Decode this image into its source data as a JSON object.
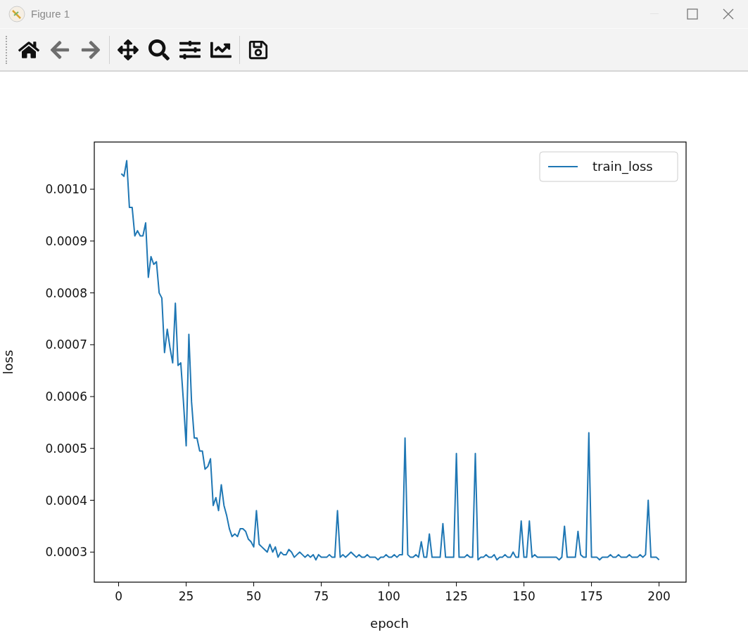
{
  "window": {
    "title": "Figure 1"
  },
  "toolbar": [
    {
      "kind": "home",
      "disabled": false
    },
    {
      "kind": "back",
      "disabled": true
    },
    {
      "kind": "forward",
      "disabled": true
    },
    {
      "kind": "pan",
      "disabled": false
    },
    {
      "kind": "zoom",
      "disabled": false
    },
    {
      "kind": "subplots",
      "disabled": false
    },
    {
      "kind": "axes",
      "disabled": false
    },
    {
      "kind": "save",
      "disabled": false
    }
  ],
  "figure": {
    "chart_data": {
      "type": "line",
      "xlabel": "epoch",
      "ylabel": "loss",
      "xlim": [
        -9,
        210
      ],
      "ylim": [
        0.000242,
        0.001091
      ],
      "xticks": [
        0,
        25,
        50,
        75,
        100,
        125,
        150,
        175,
        200
      ],
      "yticks": [
        {
          "value": 0.0003,
          "label": "0.0003"
        },
        {
          "value": 0.0004,
          "label": "0.0004"
        },
        {
          "value": 0.0005,
          "label": "0.0005"
        },
        {
          "value": 0.0006,
          "label": "0.0006"
        },
        {
          "value": 0.0007,
          "label": "0.0007"
        },
        {
          "value": 0.0008,
          "label": "0.0008"
        },
        {
          "value": 0.0009,
          "label": "0.0009"
        },
        {
          "value": 0.001,
          "label": "0.0010"
        }
      ],
      "x": [
        1,
        2,
        3,
        4,
        5,
        6,
        7,
        8,
        9,
        10,
        11,
        12,
        13,
        14,
        15,
        16,
        17,
        18,
        19,
        20,
        21,
        22,
        23,
        24,
        25,
        26,
        27,
        28,
        29,
        30,
        31,
        32,
        33,
        34,
        35,
        36,
        37,
        38,
        39,
        40,
        41,
        42,
        43,
        44,
        45,
        46,
        47,
        48,
        49,
        50,
        51,
        52,
        53,
        54,
        55,
        56,
        57,
        58,
        59,
        60,
        61,
        62,
        63,
        64,
        65,
        66,
        67,
        68,
        69,
        70,
        71,
        72,
        73,
        74,
        75,
        76,
        77,
        78,
        79,
        80,
        81,
        82,
        83,
        84,
        85,
        86,
        87,
        88,
        89,
        90,
        91,
        92,
        93,
        94,
        95,
        96,
        97,
        98,
        99,
        100,
        101,
        102,
        103,
        104,
        105,
        106,
        107,
        108,
        109,
        110,
        111,
        112,
        113,
        114,
        115,
        116,
        117,
        118,
        119,
        120,
        121,
        122,
        123,
        124,
        125,
        126,
        127,
        128,
        129,
        130,
        131,
        132,
        133,
        134,
        135,
        136,
        137,
        138,
        139,
        140,
        141,
        142,
        143,
        144,
        145,
        146,
        147,
        148,
        149,
        150,
        151,
        152,
        153,
        154,
        155,
        156,
        157,
        158,
        159,
        160,
        161,
        162,
        163,
        164,
        165,
        166,
        167,
        168,
        169,
        170,
        171,
        172,
        173,
        174,
        175,
        176,
        177,
        178,
        179,
        180,
        181,
        182,
        183,
        184,
        185,
        186,
        187,
        188,
        189,
        190,
        191,
        192,
        193,
        194,
        195,
        196,
        197,
        198,
        199,
        200
      ],
      "series": [
        {
          "name": "train_loss",
          "color": "#1f77b4",
          "values": [
            0.00103,
            0.001025,
            0.001055,
            0.000965,
            0.000965,
            0.00091,
            0.00092,
            0.00091,
            0.00091,
            0.000935,
            0.00083,
            0.00087,
            0.000855,
            0.00086,
            0.0008,
            0.00079,
            0.000685,
            0.00073,
            0.000695,
            0.000665,
            0.00078,
            0.00066,
            0.000665,
            0.00059,
            0.000505,
            0.00072,
            0.00059,
            0.00052,
            0.00052,
            0.000495,
            0.000495,
            0.00046,
            0.000465,
            0.00048,
            0.00039,
            0.000405,
            0.00038,
            0.00043,
            0.00039,
            0.00037,
            0.000345,
            0.00033,
            0.000335,
            0.00033,
            0.000345,
            0.000345,
            0.00034,
            0.000325,
            0.00032,
            0.00031,
            0.00038,
            0.000315,
            0.00031,
            0.000305,
            0.0003,
            0.000315,
            0.0003,
            0.00031,
            0.00029,
            0.0003,
            0.000295,
            0.000295,
            0.000305,
            0.0003,
            0.00029,
            0.000295,
            0.0003,
            0.000295,
            0.00029,
            0.000295,
            0.00029,
            0.000295,
            0.000285,
            0.000295,
            0.00029,
            0.00029,
            0.00029,
            0.000295,
            0.00029,
            0.00029,
            0.00038,
            0.00029,
            0.000295,
            0.00029,
            0.000295,
            0.0003,
            0.000295,
            0.00029,
            0.000295,
            0.00029,
            0.00029,
            0.000295,
            0.00029,
            0.00029,
            0.00029,
            0.000285,
            0.00029,
            0.00029,
            0.000295,
            0.00029,
            0.00029,
            0.000295,
            0.00029,
            0.000295,
            0.000295,
            0.00052,
            0.000295,
            0.00029,
            0.00029,
            0.000295,
            0.00029,
            0.00032,
            0.00029,
            0.00029,
            0.000335,
            0.00029,
            0.00029,
            0.00029,
            0.00029,
            0.000355,
            0.00029,
            0.00029,
            0.00029,
            0.00029,
            0.00049,
            0.00029,
            0.00029,
            0.00029,
            0.000295,
            0.00029,
            0.00029,
            0.00049,
            0.000285,
            0.00029,
            0.00029,
            0.000295,
            0.00029,
            0.00029,
            0.000295,
            0.000285,
            0.00029,
            0.00029,
            0.000295,
            0.00029,
            0.00029,
            0.0003,
            0.00029,
            0.00029,
            0.00036,
            0.00029,
            0.00029,
            0.00036,
            0.00029,
            0.000295,
            0.00029,
            0.00029,
            0.00029,
            0.00029,
            0.00029,
            0.00029,
            0.00029,
            0.00029,
            0.000285,
            0.00029,
            0.00035,
            0.00029,
            0.00029,
            0.00029,
            0.00029,
            0.00034,
            0.000295,
            0.00029,
            0.00029,
            0.00053,
            0.00029,
            0.00029,
            0.00029,
            0.000285,
            0.00029,
            0.00029,
            0.00029,
            0.000295,
            0.00029,
            0.00029,
            0.000295,
            0.00029,
            0.00029,
            0.00029,
            0.000295,
            0.00029,
            0.00029,
            0.00029,
            0.000295,
            0.00029,
            0.000295,
            0.0004,
            0.00029,
            0.00029,
            0.00029,
            0.000285
          ]
        }
      ]
    }
  }
}
